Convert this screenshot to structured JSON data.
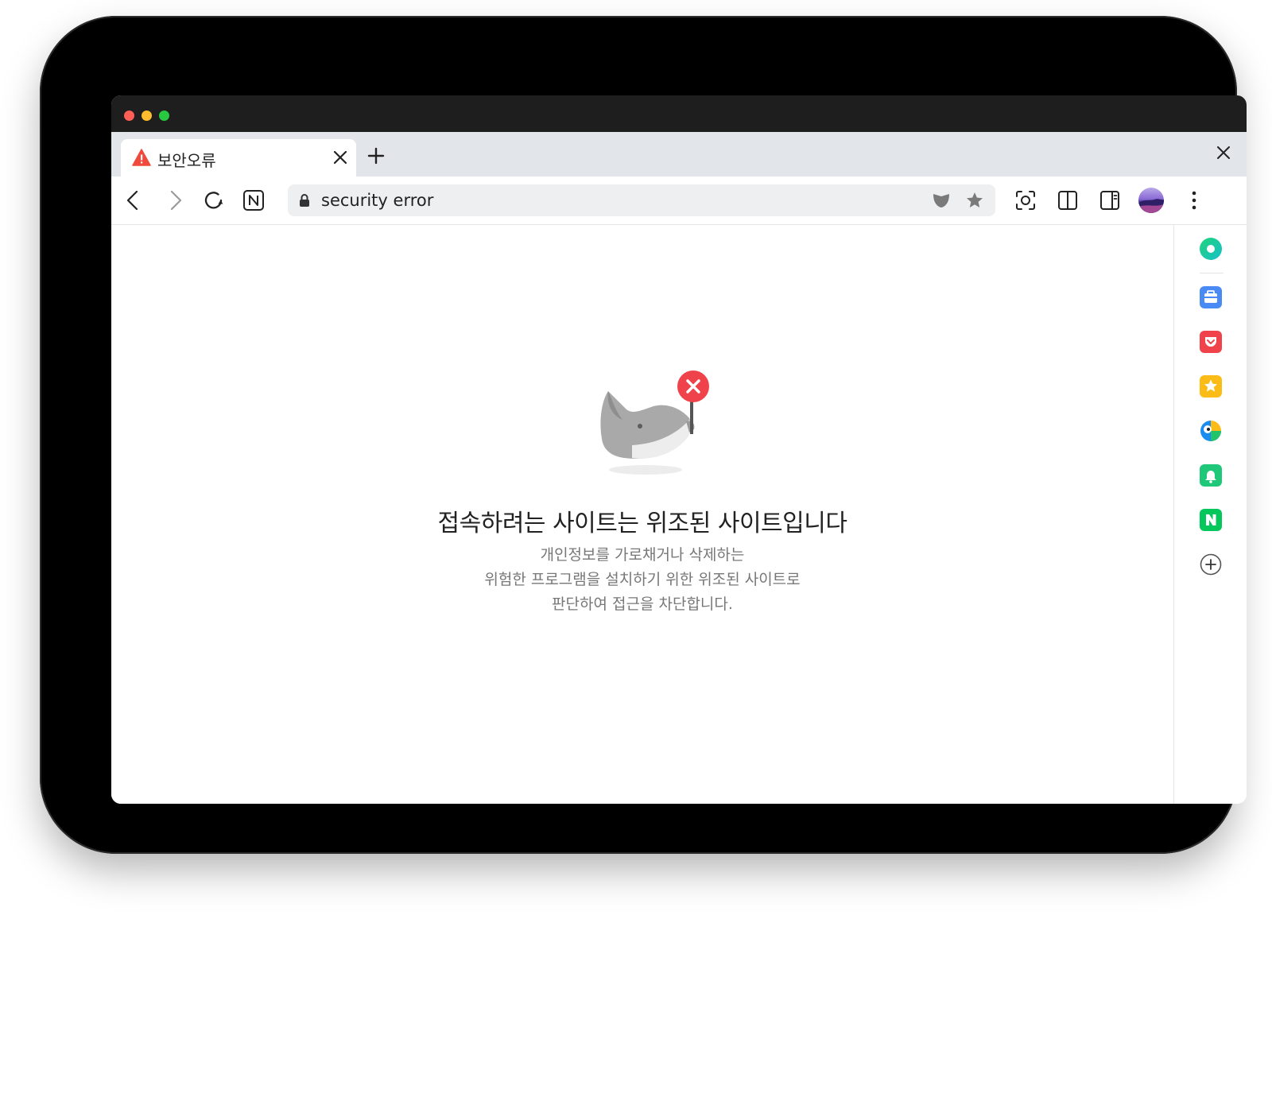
{
  "tab": {
    "title": "보안오류"
  },
  "address_bar": {
    "url": "security error"
  },
  "error": {
    "title": "접속하려는 사이트는 위조된 사이트입니다",
    "description_lines": [
      "개인정보를 가로채거나 삭제하는",
      "위험한 프로그램을 설치하기 위한 위조된 사이트로",
      "판단하여 접근을 차단합니다."
    ]
  },
  "colors": {
    "warning": "#f04a3d",
    "error_badge": "#f0424a",
    "frame": "#000000",
    "tabstrip": "#e2e5ea"
  },
  "icons": {
    "toolbar": [
      "back-icon",
      "forward-icon",
      "reload-icon",
      "naver-home-icon",
      "screen-capture-icon",
      "split-view-icon",
      "side-panel-icon",
      "profile-avatar",
      "more-menu-icon"
    ],
    "sidebar": [
      "green-circle-icon",
      "toolbox-icon",
      "pocket-icon",
      "favorites-star-icon",
      "translate-icon",
      "notification-bell-icon",
      "naver-n-icon",
      "add-icon"
    ]
  }
}
